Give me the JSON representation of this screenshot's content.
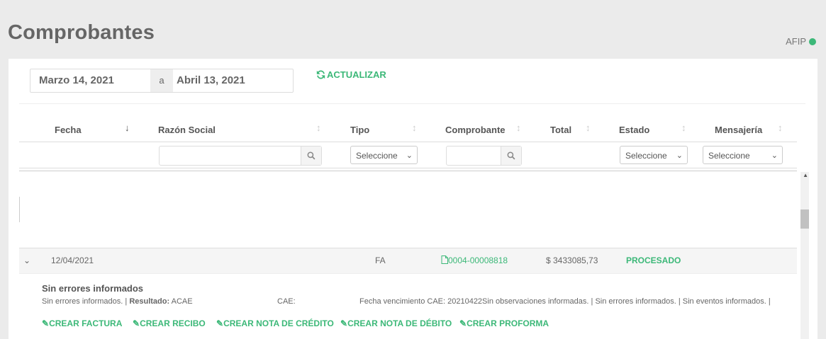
{
  "page": {
    "title": "Comprobantes"
  },
  "afip": {
    "label": "AFIP",
    "status_color": "#3cb878"
  },
  "date_range": {
    "from": "Marzo 14, 2021",
    "separator": "a",
    "to": "Abril 13, 2021"
  },
  "refresh": {
    "label": "ACTUALIZAR",
    "icon": "refresh-icon"
  },
  "columns": [
    {
      "label": "Fecha"
    },
    {
      "label": "Razón Social"
    },
    {
      "label": "Tipo"
    },
    {
      "label": "Comprobante"
    },
    {
      "label": "Total"
    },
    {
      "label": "Estado"
    },
    {
      "label": "Mensajería"
    }
  ],
  "filters": {
    "tipo": "Seleccione",
    "estado": "Seleccione",
    "mensajeria": "Seleccione"
  },
  "row": {
    "fecha": "12/04/2021",
    "tipo": "FA",
    "comprobante": "0004-00008818",
    "total": "$ 3433085,73",
    "estado": "PROCESADO"
  },
  "detail": {
    "title": "Sin errores informados",
    "errors": "Sin errores informados.",
    "resultado_label": "Resultado:",
    "resultado_value": "ACAE",
    "cae_label": "CAE:",
    "vencimiento": "Fecha vencimiento CAE: 20210422Sin observaciones informadas.",
    "sin_errores": "Sin errores informados.",
    "sin_eventos": "Sin eventos informados.",
    "sep": "|"
  },
  "actions": {
    "crear_factura": "CREAR FACTURA",
    "crear_recibo": "CREAR RECIBO",
    "crear_nota_credito": "CREAR NOTA DE CRÉDITO",
    "crear_nota_debito": "CREAR NOTA DE DÉBITO",
    "crear_proforma": "CREAR PROFORMA"
  },
  "colors": {
    "accent": "#3cb878"
  }
}
